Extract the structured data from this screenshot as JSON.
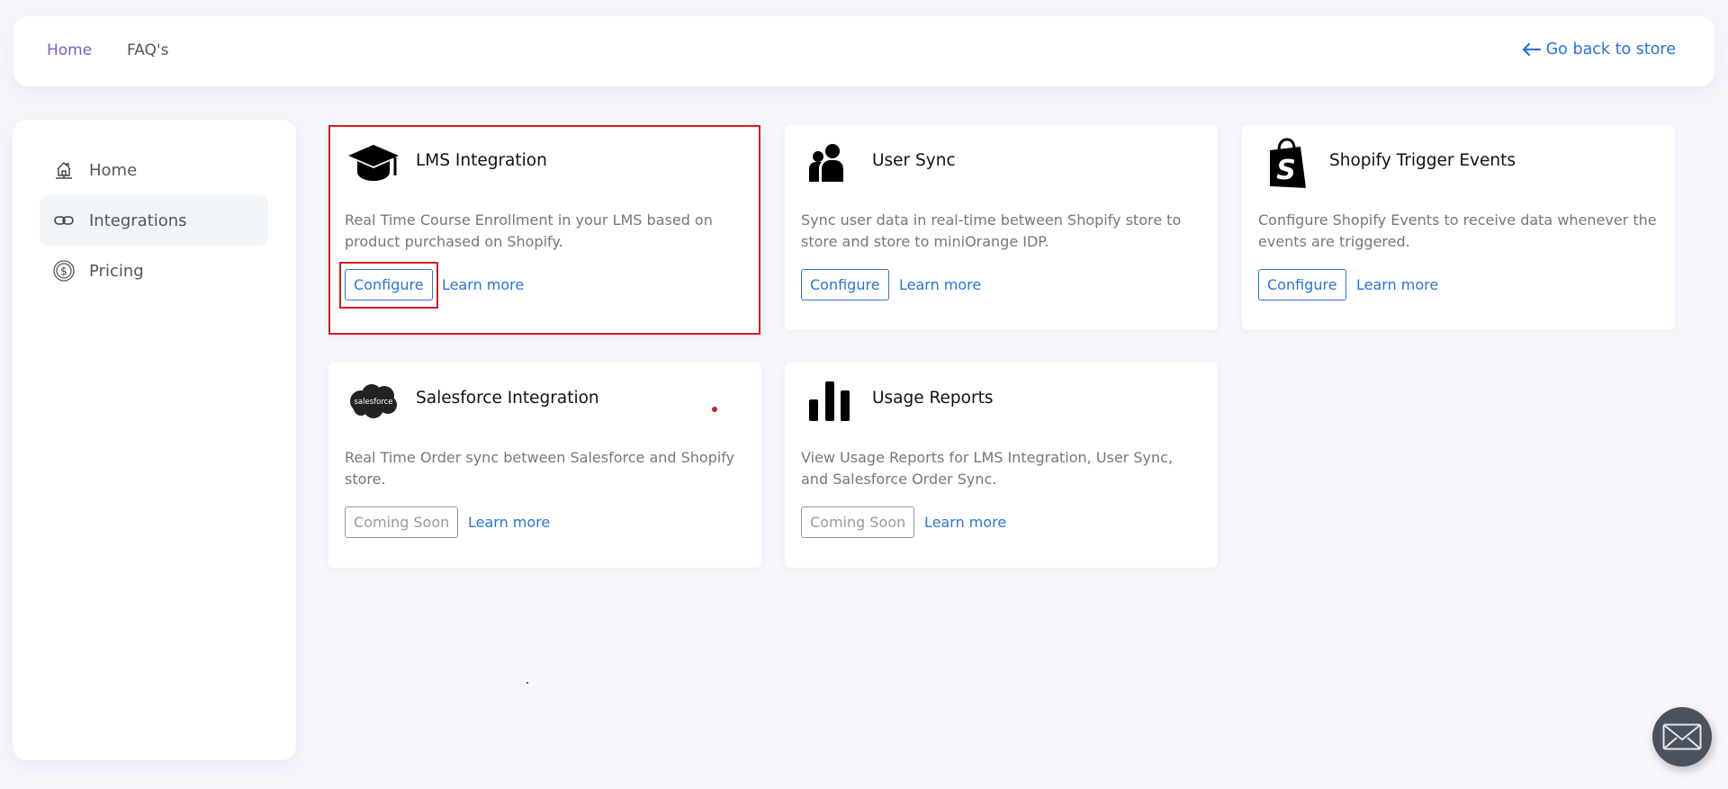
{
  "topbar": {
    "nav": [
      {
        "label": "Home",
        "active": true
      },
      {
        "label": "FAQ's",
        "active": false
      }
    ],
    "back_link": {
      "label": "Go back to store",
      "icon": "arrow-left-icon"
    }
  },
  "sidebar": {
    "items": [
      {
        "label": "Home",
        "icon": "home-icon",
        "active": false
      },
      {
        "label": "Integrations",
        "icon": "link-icon",
        "active": true
      },
      {
        "label": "Pricing",
        "icon": "dollar-circle-icon",
        "active": false
      }
    ]
  },
  "cards": [
    {
      "title": "LMS Integration",
      "icon": "graduation-cap-icon",
      "description": "Real Time Course Enrollment in your LMS based on product purchased on Shopify.",
      "button": "Configure",
      "button_enabled": true,
      "link": "Learn more"
    },
    {
      "title": "User Sync",
      "icon": "users-icon",
      "description": "Sync user data in real-time between Shopify store to store and store to miniOrange IDP.",
      "button": "Configure",
      "button_enabled": true,
      "link": "Learn more"
    },
    {
      "title": "Shopify Trigger Events",
      "icon": "shopify-bag-icon",
      "description": "Configure Shopify Events to receive data whenever the events are triggered.",
      "button": "Configure",
      "button_enabled": true,
      "link": "Learn more"
    },
    {
      "title": "Salesforce Integration",
      "icon": "salesforce-cloud-icon",
      "icon_text": "salesforce",
      "description": "Real Time Order sync between Salesforce and Shopify store.",
      "button": "Coming Soon",
      "button_enabled": false,
      "link": "Learn more"
    },
    {
      "title": "Usage Reports",
      "icon": "bar-chart-icon",
      "description": "View Usage Reports for LMS Integration, User Sync, and Salesforce Order Sync.",
      "button": "Coming Soon",
      "button_enabled": false,
      "link": "Learn more"
    }
  ],
  "colors": {
    "accent_blue": "#2a74d6",
    "nav_active_purple": "#7a5cc9",
    "highlight_red": "#d01c24",
    "background": "#f6f7fd",
    "fab": "#4a5260"
  },
  "contact_fab": {
    "icon": "mail-icon"
  }
}
